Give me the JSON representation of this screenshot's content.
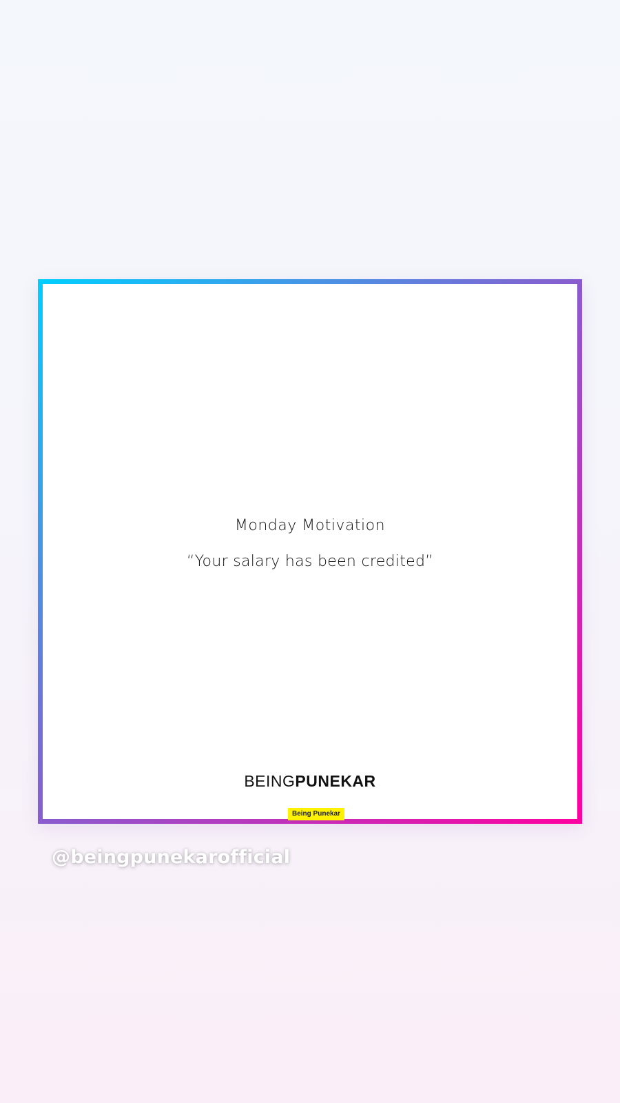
{
  "post": {
    "title": "Monday Motivation",
    "quote": "“Your salary has been credited”",
    "brand": {
      "light": "BEING",
      "bold": "PUNEKAR"
    },
    "frame_colors": [
      "#00cfff",
      "#8a5ccf",
      "#ff00a0"
    ]
  },
  "badge": {
    "label": "Being Punekar",
    "color": "#fff200"
  },
  "story": {
    "handle": "@beingpunekarofficial"
  }
}
